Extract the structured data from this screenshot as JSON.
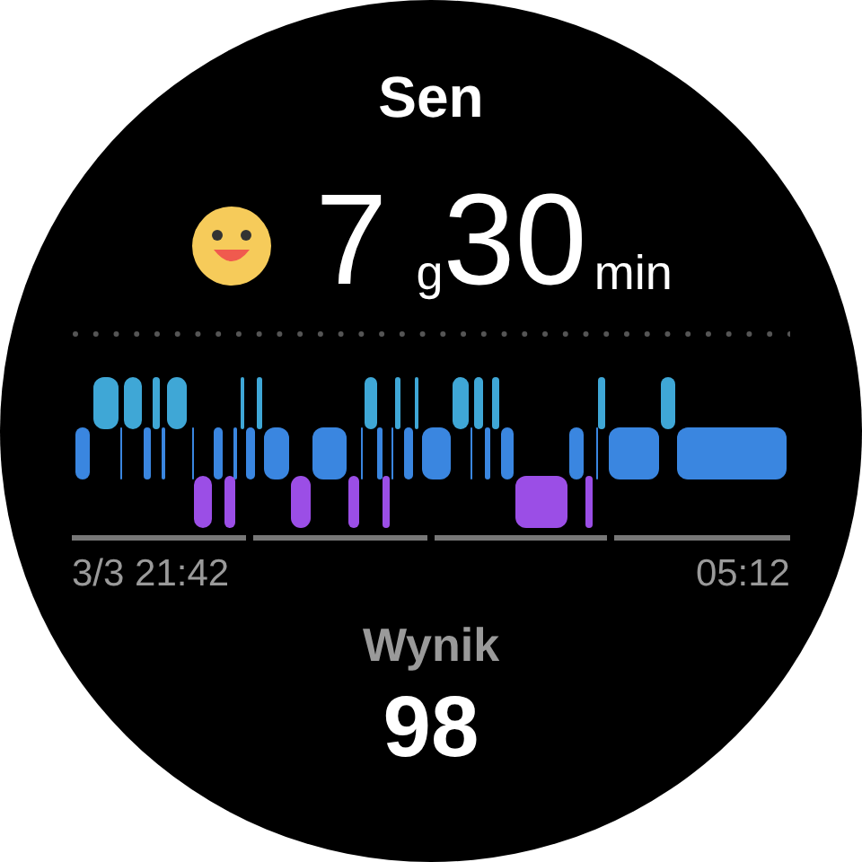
{
  "title": "Sen",
  "duration": {
    "hours": "7",
    "hours_unit": "g",
    "minutes": "30",
    "minutes_unit": "min"
  },
  "chart": {
    "start_label": "3/3 21:42",
    "end_label": "05:12"
  },
  "score": {
    "label": "Wynik",
    "value": "98"
  }
}
